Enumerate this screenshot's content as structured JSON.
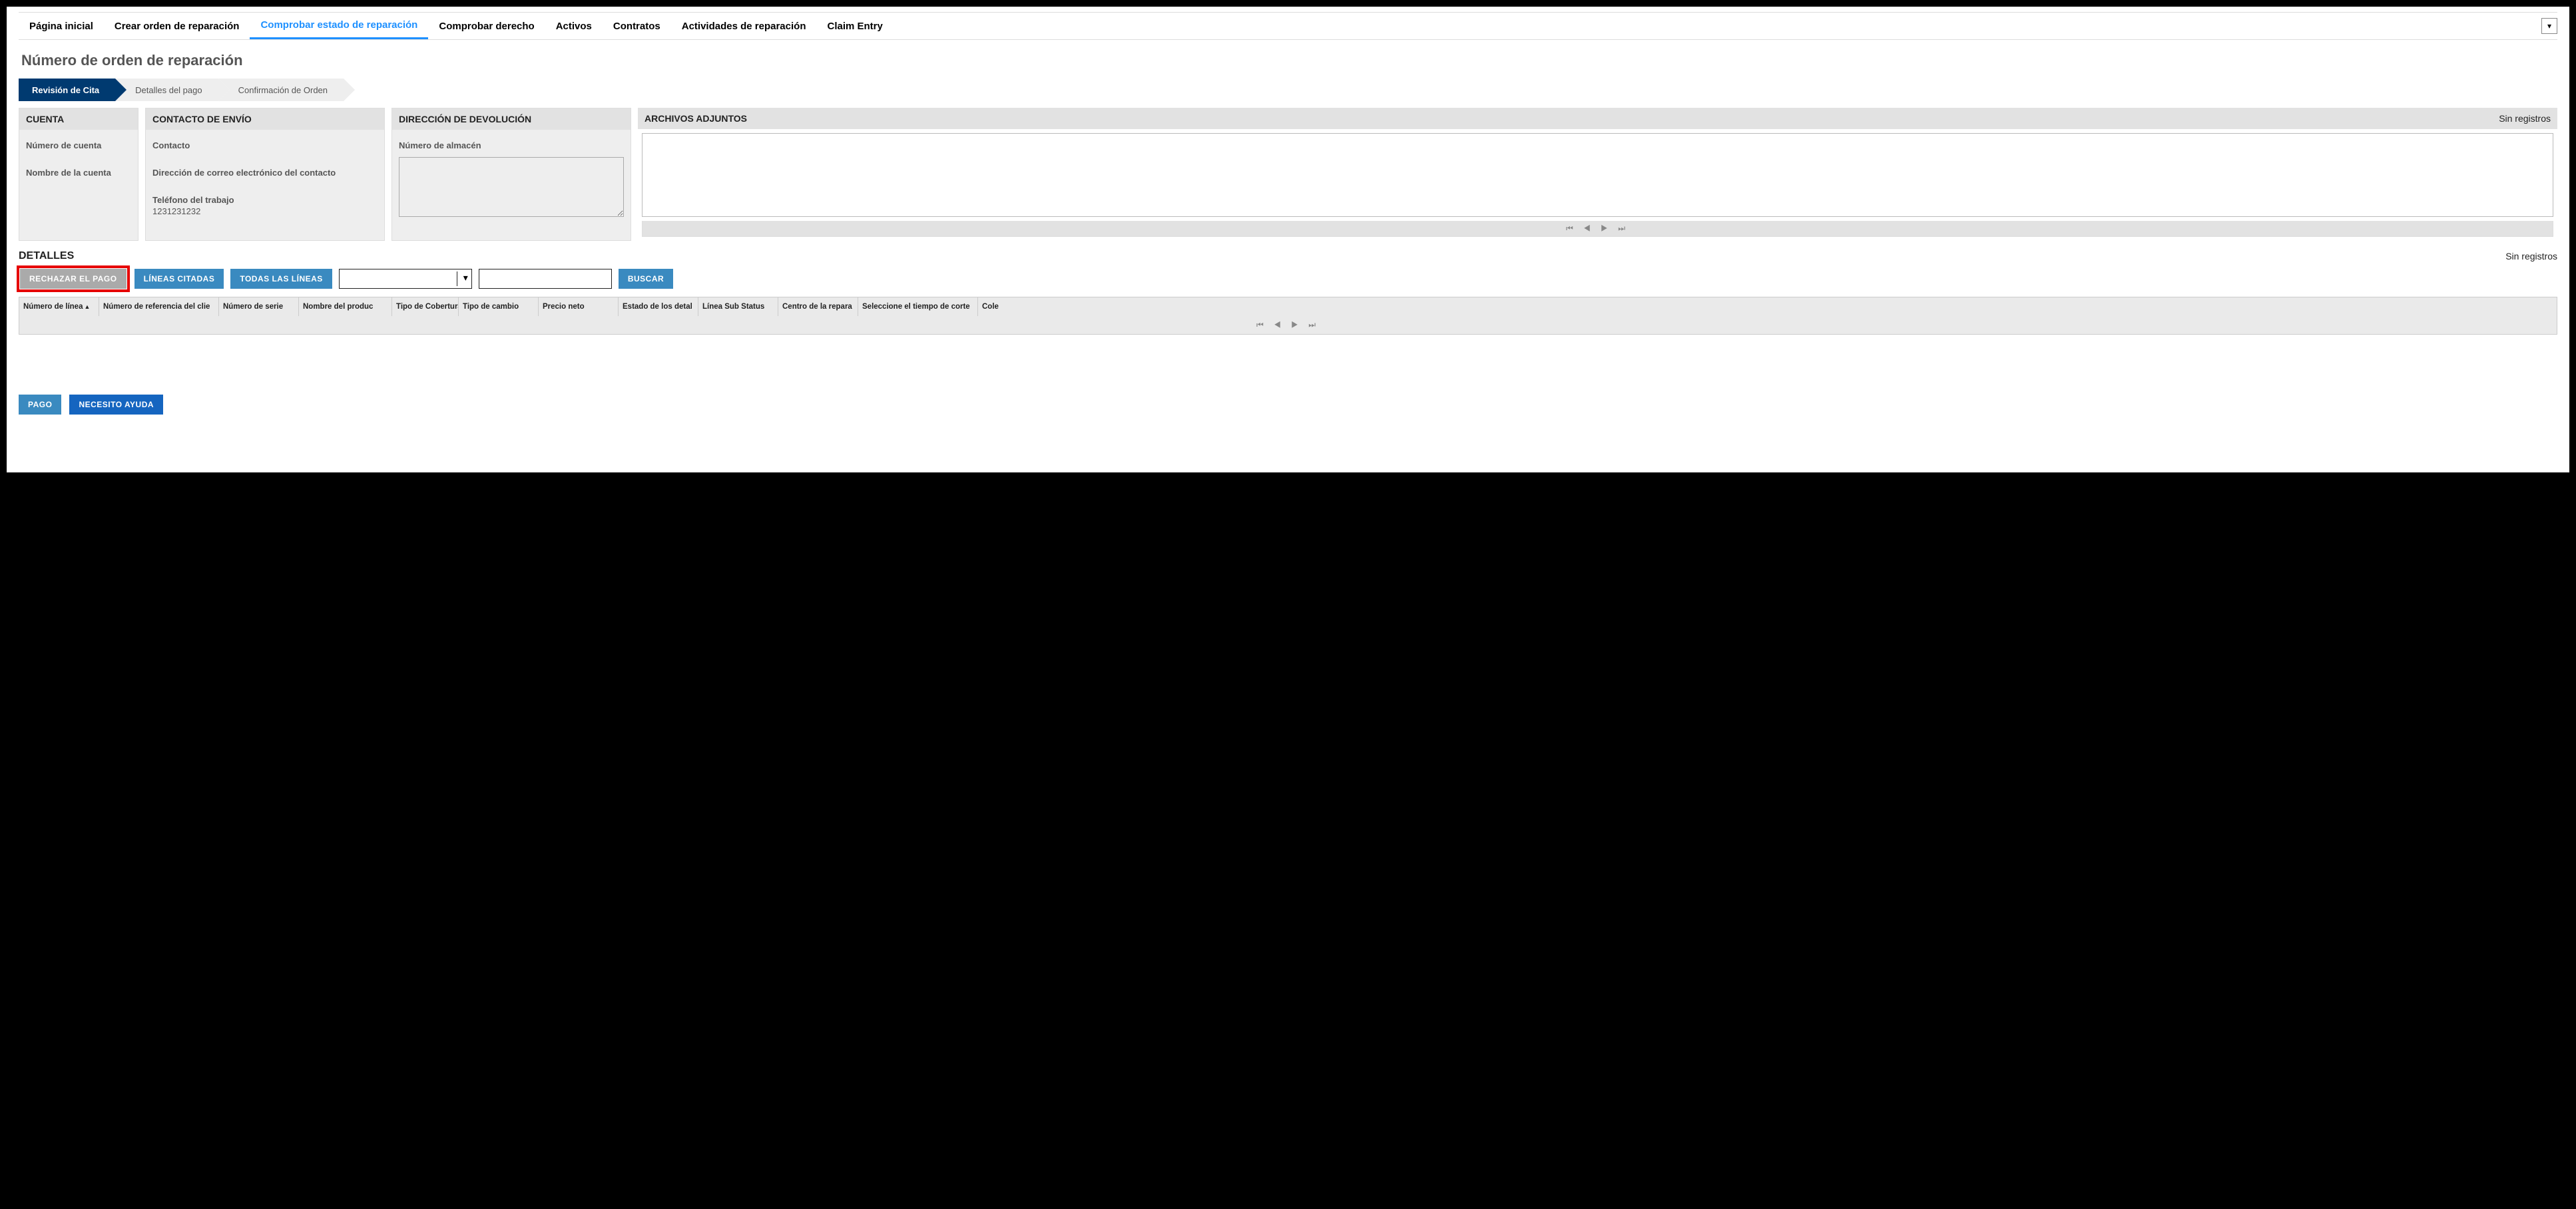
{
  "nav": {
    "items": [
      "Página inicial",
      "Crear orden de reparación",
      "Comprobar estado de reparación",
      "Comprobar derecho",
      "Activos",
      "Contratos",
      "Actividades de reparación",
      "Claim Entry"
    ],
    "active_index": 2
  },
  "page_title": "Número de orden de reparación",
  "stepper": {
    "steps": [
      "Revisión de Cita",
      "Detalles del pago",
      "Confirmación de Orden"
    ],
    "active_index": 0
  },
  "cards": {
    "account": {
      "title": "CUENTA",
      "number_label": "Número de cuenta",
      "name_label": "Nombre de la cuenta"
    },
    "contact": {
      "title": "CONTACTO DE ENVÍO",
      "contact_label": "Contacto",
      "email_label": "Dirección de correo electrónico del contacto",
      "phone_label": "Teléfono del trabajo",
      "phone_value": "1231231232"
    },
    "return": {
      "title": "DIRECCIÓN DE DEVOLUCIÓN",
      "warehouse_label": "Número de almacén"
    },
    "attachments": {
      "title": "ARCHIVOS ADJUNTOS",
      "no_records": "Sin registros"
    }
  },
  "details": {
    "title": "DETALLES",
    "no_records": "Sin registros",
    "buttons": {
      "reject_payment": "RECHAZAR EL PAGO",
      "cited_lines": "LÍNEAS CITADAS",
      "all_lines": "TODAS LAS LÍNEAS",
      "search": "BUSCAR"
    },
    "columns": [
      "Número de línea",
      "Número de referencia del clie",
      "Número de serie",
      "Nombre del produc",
      "Tipo de Cobertura",
      "Tipo de cambio",
      "Precio neto",
      "Estado de los detal",
      "Línea Sub Status",
      "Centro de la repara",
      "Seleccione el tiempo de corte",
      "Cole"
    ],
    "sort_column_index": 0
  },
  "footer": {
    "pay": "PAGO",
    "help": "NECESITO AYUDA"
  },
  "pager_glyphs": "⏮ ◀ ▶ ⏭"
}
